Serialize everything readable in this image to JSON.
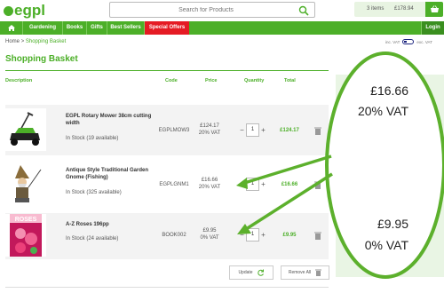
{
  "header": {
    "logo_text": "egpl",
    "search_placeholder": "Search for Products",
    "basket_count": "3 items",
    "basket_total": "£178.94"
  },
  "nav": {
    "items": [
      "Gardening",
      "Books",
      "Gifts",
      "Best Sellers",
      "Special Offers"
    ],
    "login": "Login"
  },
  "breadcrumb": {
    "home": "Home",
    "sep": ">",
    "current": "Shopping Basket"
  },
  "vat_toggle": {
    "inc": "inc. VAT",
    "exc": "exc. VAT"
  },
  "page_title": "Shopping Basket",
  "table": {
    "headers": [
      "Description",
      "Code",
      "Price",
      "Quantity",
      "Total"
    ],
    "rows": [
      {
        "name": "EGPL Rotary Mower 38cm cutting width",
        "stock": "In Stock (19 available)",
        "code": "EGPLMOW3",
        "price": "£124.17",
        "vat": "20% VAT",
        "qty": "1",
        "total": "£124.17"
      },
      {
        "name": "Antique Style Traditional Garden Gnome (Fishing)",
        "stock": "In Stock (325 available)",
        "code": "EGPLGNM1",
        "price": "£16.66",
        "vat": "20% VAT",
        "qty": "1",
        "total": "£16.66"
      },
      {
        "name": "A-Z Roses 196pp",
        "stock": "In Stock (24 available)",
        "code": "BOOK002",
        "price": "£9.95",
        "vat": "0% VAT",
        "qty": "1",
        "total": "£9.95"
      }
    ]
  },
  "actions": {
    "update": "Update",
    "remove_all": "Remove All"
  },
  "book_cover_text": "ROSES",
  "callouts": [
    {
      "price": "£16.66",
      "vat": "20% VAT"
    },
    {
      "price": "£9.95",
      "vat": "0% VAT"
    }
  ],
  "colors": {
    "brand": "#4caf28",
    "offers": "#e51b24",
    "panel": "#e9f5e4"
  }
}
